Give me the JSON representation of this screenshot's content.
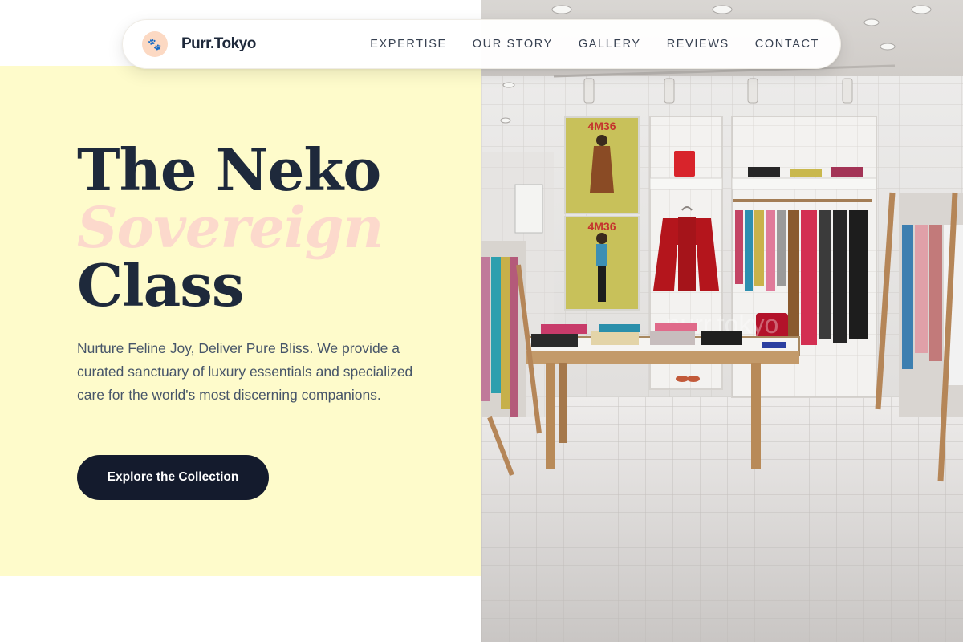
{
  "brand": {
    "name": "Purr.Tokyo",
    "icon": "paw-icon"
  },
  "nav": {
    "links": [
      "EXPERTISE",
      "OUR STORY",
      "GALLERY",
      "REVIEWS",
      "CONTACT"
    ]
  },
  "hero": {
    "title_line1": "The Neko",
    "title_line2": "Sovereign",
    "title_line3": "Class",
    "description": "Nurture Feline Joy, Deliver Pure Bliss. We provide a curated sanctuary of luxury essentials and specialized care for the world's most discerning companions.",
    "cta_label": "Explore the Collection"
  },
  "photo": {
    "poster_text": "4M36",
    "watermark": "purr.tokyo"
  },
  "colors": {
    "hero_bg": "#fefbcb",
    "accent_peach": "#fcd9cc",
    "dark": "#141b2d"
  }
}
